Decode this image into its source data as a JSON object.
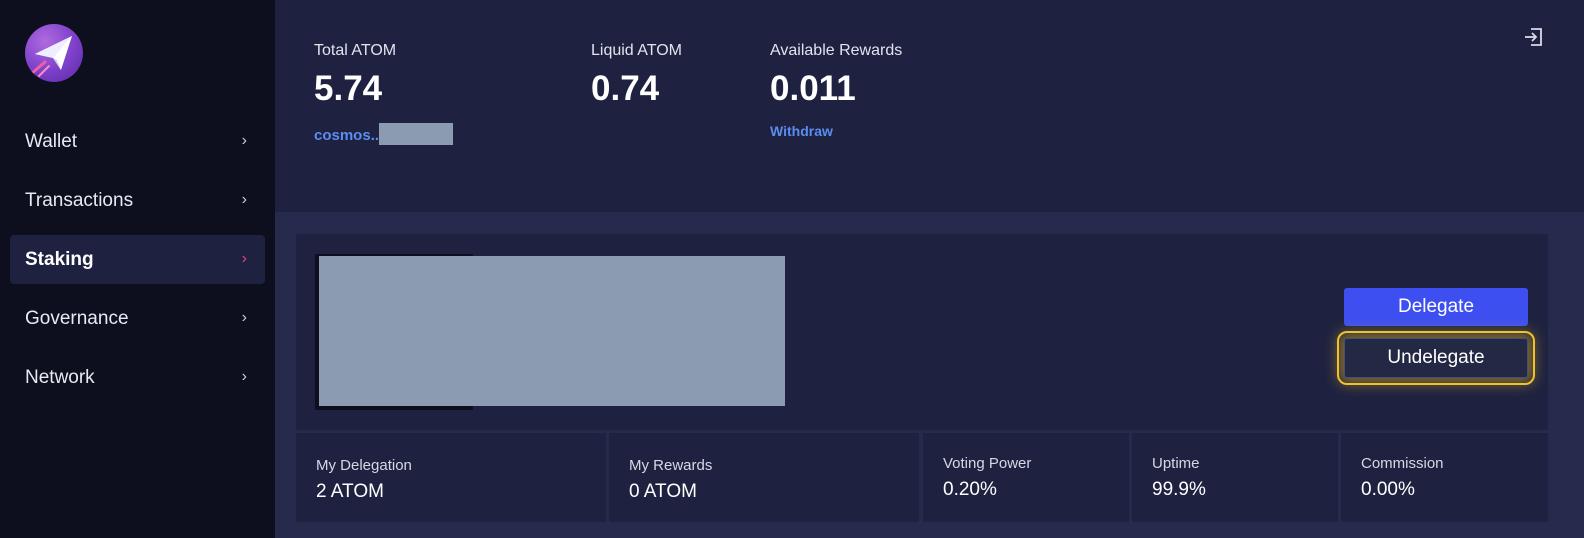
{
  "sidebar": {
    "items": [
      {
        "label": "Wallet",
        "active": false
      },
      {
        "label": "Transactions",
        "active": false
      },
      {
        "label": "Staking",
        "active": true
      },
      {
        "label": "Governance",
        "active": false
      },
      {
        "label": "Network",
        "active": false
      }
    ],
    "chevron": "›"
  },
  "header": {
    "total": {
      "label": "Total ATOM",
      "value": "5.74",
      "address": "cosmos.."
    },
    "liquid": {
      "label": "Liquid ATOM",
      "value": "0.74"
    },
    "rewards": {
      "label": "Available Rewards",
      "value": "0.011",
      "link": "Withdraw"
    }
  },
  "validator": {
    "delegate_label": "Delegate",
    "undelegate_label": "Undelegate",
    "stats": [
      {
        "label": "My Delegation",
        "value": "2 ATOM"
      },
      {
        "label": "My Rewards",
        "value": "0 ATOM"
      },
      {
        "label": "Voting Power",
        "value": "0.20%"
      },
      {
        "label": "Uptime",
        "value": "99.9%"
      },
      {
        "label": "Commission",
        "value": "0.00%"
      }
    ]
  },
  "colors": {
    "accent": "#3d4ff0",
    "link": "#5b8cf0",
    "highlight": "#f3c026",
    "active_chevron": "#e0457b"
  },
  "icons": {
    "logo": "paper-plane-logo",
    "logout": "logout-icon",
    "chevron": "chevron-right-icon"
  }
}
